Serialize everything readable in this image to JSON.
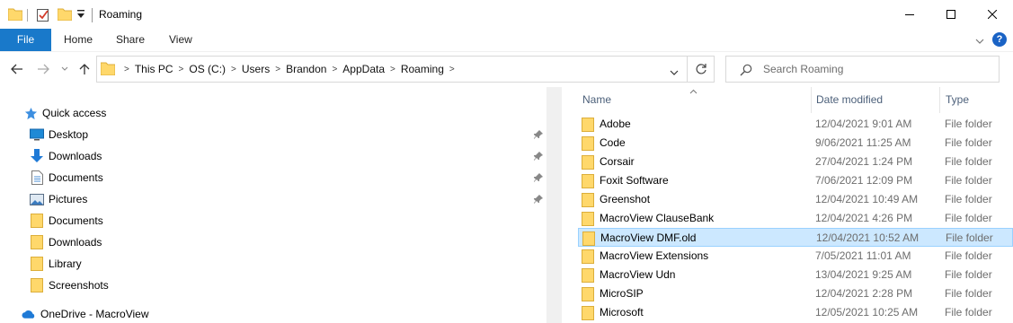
{
  "window": {
    "title": "Roaming"
  },
  "ribbon": {
    "tabs": [
      "File",
      "Home",
      "Share",
      "View"
    ],
    "help_label": "?"
  },
  "nav": {
    "breadcrumbs": [
      "This PC",
      "OS (C:)",
      "Users",
      "Brandon",
      "AppData",
      "Roaming"
    ],
    "search_placeholder": "Search Roaming"
  },
  "sidebar": {
    "quick_access": "Quick access",
    "items": [
      {
        "label": "Desktop",
        "icon": "desktop-icon",
        "pinned": true
      },
      {
        "label": "Downloads",
        "icon": "download-arrow-icon",
        "pinned": true
      },
      {
        "label": "Documents",
        "icon": "document-icon",
        "pinned": true
      },
      {
        "label": "Pictures",
        "icon": "pictures-icon",
        "pinned": true
      },
      {
        "label": "Documents",
        "icon": "folder-icon",
        "pinned": false
      },
      {
        "label": "Downloads",
        "icon": "folder-icon",
        "pinned": false
      },
      {
        "label": "Library",
        "icon": "folder-icon",
        "pinned": false
      },
      {
        "label": "Screenshots",
        "icon": "folder-icon",
        "pinned": false
      }
    ],
    "onedrive": "OneDrive - MacroView"
  },
  "filelist": {
    "columns": [
      "Name",
      "Date modified",
      "Type"
    ],
    "rows": [
      {
        "name": "Adobe",
        "date": "12/04/2021 9:01 AM",
        "type": "File folder"
      },
      {
        "name": "Code",
        "date": "9/06/2021 11:25 AM",
        "type": "File folder"
      },
      {
        "name": "Corsair",
        "date": "27/04/2021 1:24 PM",
        "type": "File folder"
      },
      {
        "name": "Foxit Software",
        "date": "7/06/2021 12:09 PM",
        "type": "File folder"
      },
      {
        "name": "Greenshot",
        "date": "12/04/2021 10:49 AM",
        "type": "File folder"
      },
      {
        "name": "MacroView ClauseBank",
        "date": "12/04/2021 4:26 PM",
        "type": "File folder"
      },
      {
        "name": "MacroView DMF.old",
        "date": "12/04/2021 10:52 AM",
        "type": "File folder",
        "selected": true
      },
      {
        "name": "MacroView Extensions",
        "date": "7/05/2021 11:01 AM",
        "type": "File folder"
      },
      {
        "name": "MacroView Udn",
        "date": "13/04/2021 9:25 AM",
        "type": "File folder"
      },
      {
        "name": "MicroSIP",
        "date": "12/04/2021 2:28 PM",
        "type": "File folder"
      },
      {
        "name": "Microsoft",
        "date": "12/05/2021 10:25 AM",
        "type": "File folder"
      }
    ]
  },
  "colors": {
    "accent": "#1979ca",
    "selection": "#cce8ff",
    "folder": "#ffd86b",
    "header_text": "#4c607a"
  }
}
